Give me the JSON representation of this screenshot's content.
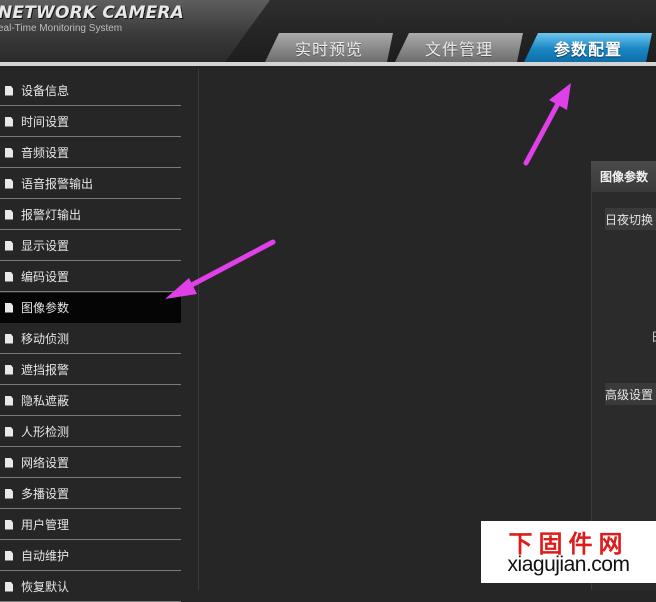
{
  "header": {
    "brand_title": "NETWORK CAMERA",
    "brand_subtitle": "eal-Time Monitoring System",
    "tabs": [
      {
        "label": "实时预览",
        "active": false
      },
      {
        "label": "文件管理",
        "active": false
      },
      {
        "label": "参数配置",
        "active": true
      }
    ]
  },
  "sidebar": {
    "items": [
      {
        "label": "设备信息",
        "active": false
      },
      {
        "label": "时间设置",
        "active": false
      },
      {
        "label": "音频设置",
        "active": false
      },
      {
        "label": "语音报警输出",
        "active": false
      },
      {
        "label": "报警灯输出",
        "active": false
      },
      {
        "label": "显示设置",
        "active": false
      },
      {
        "label": "编码设置",
        "active": false
      },
      {
        "label": "图像参数",
        "active": true
      },
      {
        "label": "移动侦测",
        "active": false
      },
      {
        "label": "遮挡报警",
        "active": false
      },
      {
        "label": "隐私遮蔽",
        "active": false
      },
      {
        "label": "人形检测",
        "active": false
      },
      {
        "label": "网络设置",
        "active": false
      },
      {
        "label": "多播设置",
        "active": false
      },
      {
        "label": "用户管理",
        "active": false
      },
      {
        "label": "自动维护",
        "active": false
      },
      {
        "label": "恢复默认",
        "active": false
      }
    ]
  },
  "panel": {
    "title": "图像参数",
    "day_night_label": "日夜切换",
    "advanced_label": "高级设置",
    "cut_char": "日"
  },
  "watermark": {
    "cn": "下固件网",
    "en": "xiagujian.com"
  },
  "colors": {
    "annotation_arrow": "#e040e8",
    "active_tab": "#1a86c4",
    "watermark_red": "#e01b1b"
  }
}
